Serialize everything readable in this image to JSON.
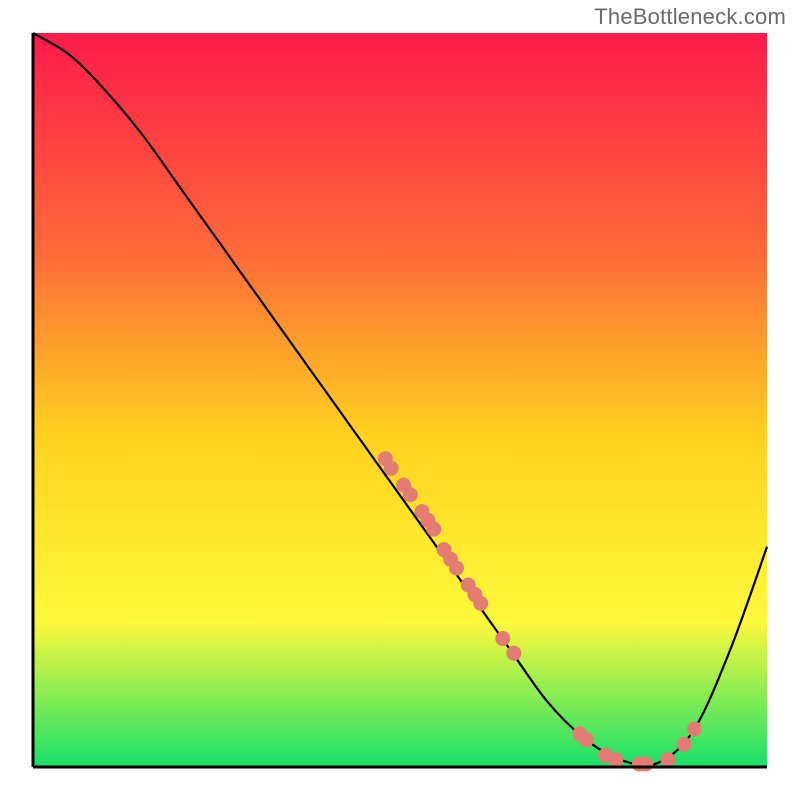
{
  "watermark": "TheBottleneck.com",
  "colors": {
    "gradient_top": "#ff1a4b",
    "gradient_mid_upper": "#ff6a38",
    "gradient_mid": "#ffd21f",
    "gradient_mid_lower": "#fff93a",
    "gradient_bottom": "#17e06a",
    "axis": "#000000",
    "curve": "#000000",
    "marker_fill": "#e57c74",
    "marker_stroke": "#cc5a52"
  },
  "chart_data": {
    "type": "line",
    "title": "",
    "xlabel": "",
    "ylabel": "",
    "xlim": [
      0,
      100
    ],
    "ylim": [
      0,
      100
    ],
    "legend": false,
    "grid": false,
    "series": [
      {
        "name": "curve",
        "x": [
          0,
          5,
          10,
          15,
          20,
          25,
          30,
          35,
          40,
          45,
          50,
          55,
          60,
          65,
          70,
          75,
          80,
          85,
          90,
          95,
          100
        ],
        "y": [
          100,
          97,
          92,
          86,
          79,
          72,
          65,
          58,
          51,
          44,
          37,
          30,
          23,
          16,
          9,
          4,
          1,
          0.5,
          5,
          16,
          30
        ]
      }
    ],
    "markers": [
      {
        "x": 48,
        "y": 42
      },
      {
        "x": 48.8,
        "y": 40.7
      },
      {
        "x": 50.5,
        "y": 38.4
      },
      {
        "x": 51.4,
        "y": 37.1
      },
      {
        "x": 53,
        "y": 34.8
      },
      {
        "x": 53.8,
        "y": 33.6
      },
      {
        "x": 54.6,
        "y": 32.4
      },
      {
        "x": 56,
        "y": 29.6
      },
      {
        "x": 56.9,
        "y": 28.3
      },
      {
        "x": 57.7,
        "y": 27.1
      },
      {
        "x": 59.3,
        "y": 24.8
      },
      {
        "x": 60.2,
        "y": 23.5
      },
      {
        "x": 61,
        "y": 22.3
      },
      {
        "x": 64,
        "y": 17.5
      },
      {
        "x": 65.5,
        "y": 15.5
      },
      {
        "x": 74.5,
        "y": 4.5
      },
      {
        "x": 75.4,
        "y": 3.7
      },
      {
        "x": 78,
        "y": 1.6
      },
      {
        "x": 79.4,
        "y": 1.0
      },
      {
        "x": 82.6,
        "y": 0.4
      },
      {
        "x": 83.5,
        "y": 0.4
      },
      {
        "x": 86.5,
        "y": 1.0
      },
      {
        "x": 88.7,
        "y": 3.1
      },
      {
        "x": 90.1,
        "y": 5.2
      }
    ]
  }
}
